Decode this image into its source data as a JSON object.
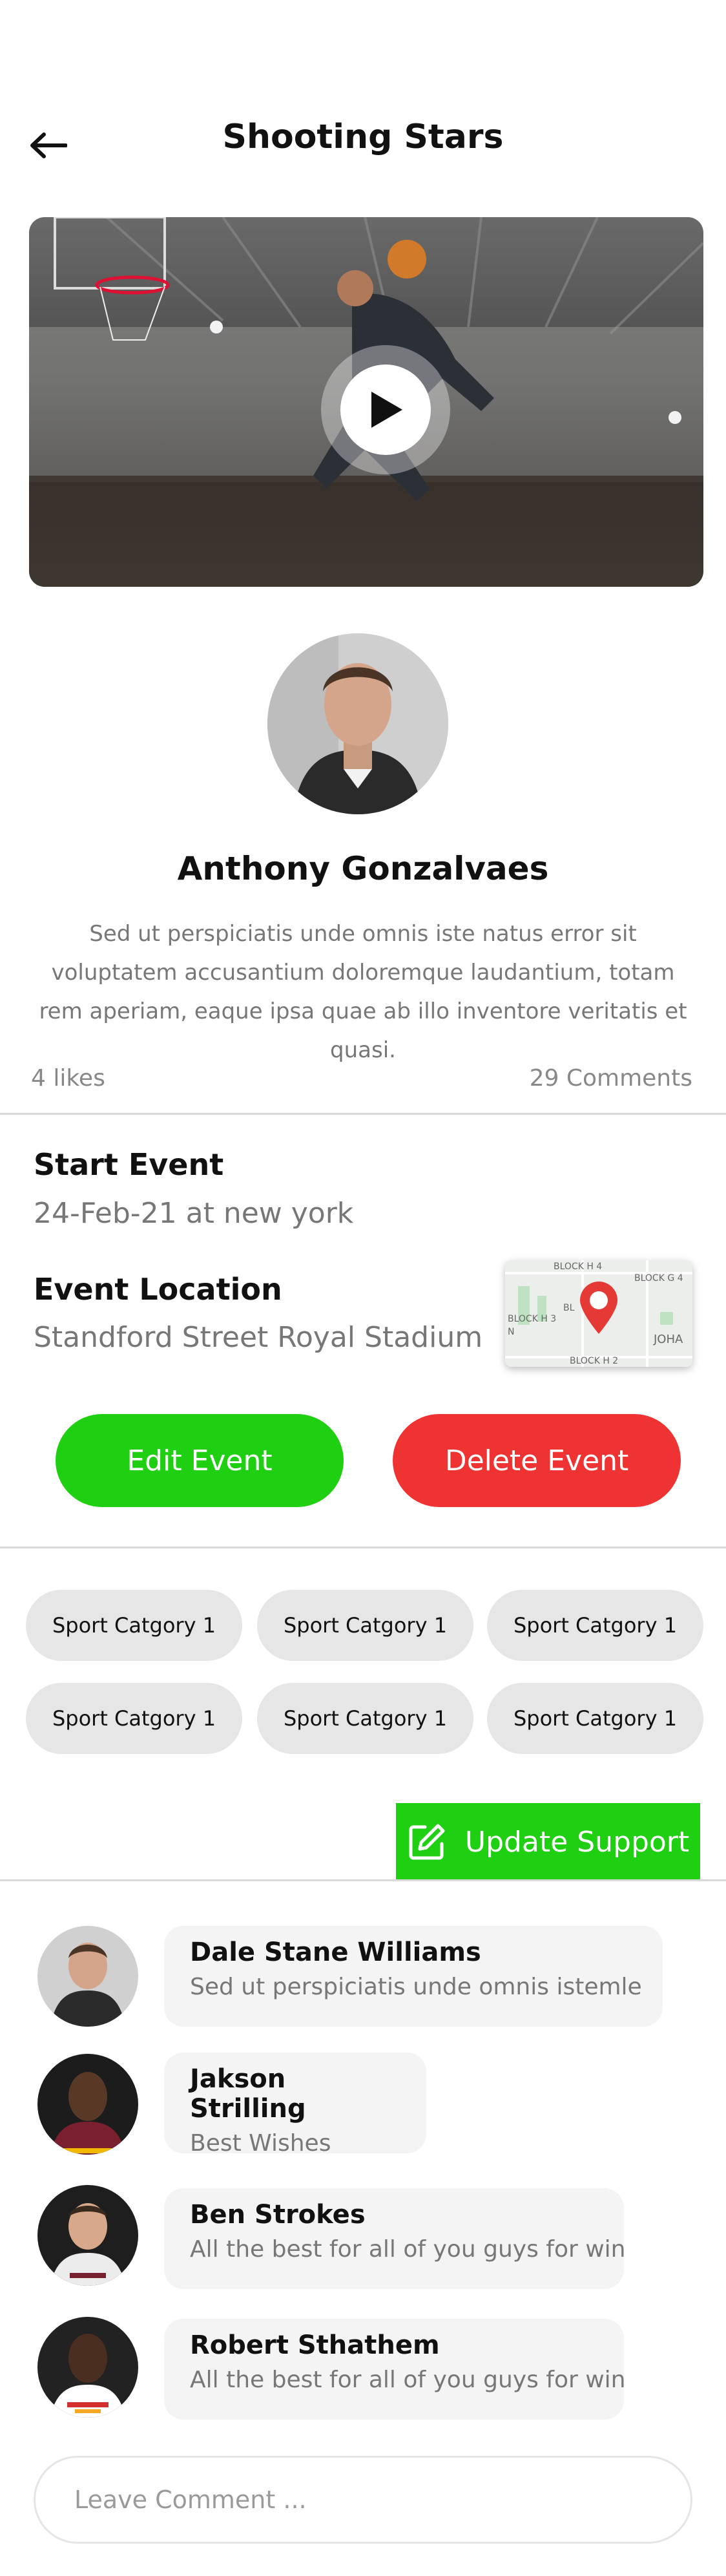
{
  "header": {
    "title": "Shooting Stars",
    "back_icon": "arrow-left-icon"
  },
  "video": {
    "play_icon": "play-icon"
  },
  "profile": {
    "name": "Anthony Gonzalvaes",
    "bio": "Sed ut perspiciatis unde omnis iste natus error sit voluptatem accusantium doloremque laudantium, totam rem aperiam, eaque ipsa quae ab illo inventore veritatis et quasi."
  },
  "stats": {
    "likes": "4 likes",
    "comments": "29 Comments"
  },
  "event": {
    "start_label": "Start Event",
    "start_value": "24-Feb-21 at new york",
    "location_label": "Event Location",
    "location_value": "Standford Street Royal Stadium",
    "map_labels": [
      "BLOCK H 4",
      "BLOCK G 4",
      "BLOCK H 3",
      "BL",
      "N",
      "BLOCK H 2",
      "JOHA"
    ]
  },
  "actions": {
    "edit_label": "Edit Event",
    "delete_label": "Delete Event",
    "edit_color": "#1ecf12",
    "delete_color": "#ef3333"
  },
  "categories": [
    "Sport Catgory 1",
    "Sport Catgory 1",
    "Sport Catgory 1",
    "Sport Catgory 1",
    "Sport Catgory 1",
    "Sport Catgory 1"
  ],
  "support": {
    "update_label": "Update Support",
    "icon": "edit-icon"
  },
  "comments": [
    {
      "name": "Dale Stane Williams",
      "text": "Sed ut perspiciatis unde omnis istemle"
    },
    {
      "name": "Jakson Strilling",
      "text": "Best Wishes"
    },
    {
      "name": "Ben Strokes",
      "text": "All the best for all of you guys for win"
    },
    {
      "name": "Robert Sthathem",
      "text": "All the best for all of you guys for win"
    }
  ],
  "comment_input": {
    "placeholder": "Leave Comment ..."
  }
}
